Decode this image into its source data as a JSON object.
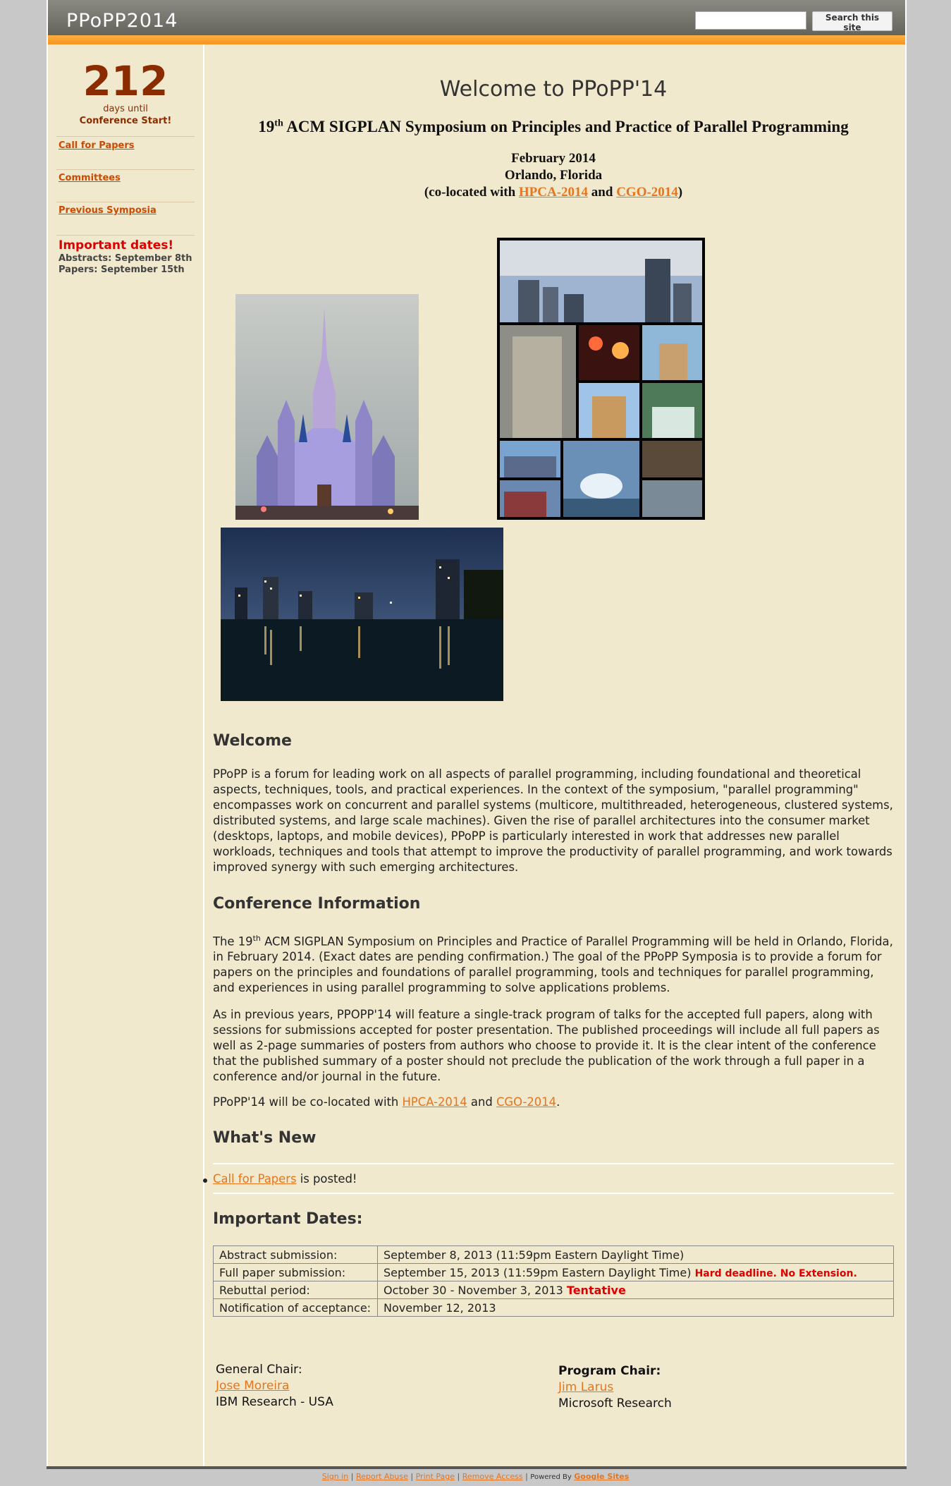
{
  "header": {
    "site_title": "PPoPP2014",
    "search_placeholder": "",
    "search_button": "Search this site"
  },
  "sidebar": {
    "countdown_number": "212",
    "countdown_line1": "days until",
    "countdown_line2": "Conference Start!",
    "links": [
      "Call for Papers",
      "Committees",
      "Previous Symposia"
    ],
    "important_title": "Important dates!",
    "important_lines": [
      "Abstracts: September 8th",
      "Papers: September 15th"
    ]
  },
  "main": {
    "welcome_title": "Welcome to PPoPP'14",
    "symposium_prefix": "19",
    "symposium_sup": "th",
    "symposium_rest": "ACM SIGPLAN Symposium on Principles and Practice of Parallel Programming",
    "date": "February 2014",
    "location": "Orlando, Florida",
    "coloc_prefix": "(co-located with",
    "coloc_link1": "HPCA-2014",
    "coloc_and": "and",
    "coloc_link2": "CGO-2014",
    "coloc_suffix": ")",
    "welcome_heading": "Welcome",
    "welcome_para": "PPoPP is a forum for leading work on all aspects of parallel programming, including foundational and theoretical aspects, techniques, tools, and practical experiences. In the context of the symposium, \"parallel programming\" encompasses work on concurrent and parallel systems (multicore, multithreaded, heterogeneous, clustered systems, distributed systems, and large scale machines). Given the rise of parallel architectures into the consumer market (desktops, laptops, and mobile devices), PPoPP is particularly interested in work that addresses new parallel workloads, techniques and tools that attempt to improve the productivity of parallel programming, and work towards improved synergy with such emerging architectures.",
    "conf_info_heading": "Conference Information",
    "conf_para1_prefix": "The 19",
    "conf_para1_sup": "th",
    "conf_para1_rest": " ACM SIGPLAN Symposium on Principles and Practice of Parallel Programming will be held in Orlando, Florida, in February 2014. (Exact dates are pending confirmation.) The goal of the PPoPP Symposia is to provide a forum for papers on the principles and foundations of parallel programming, tools and techniques for parallel programming, and experiences in using parallel programming to solve applications problems.",
    "conf_para2": "As in previous years, PPOPP'14 will feature a single-track program of talks for the accepted full papers, along with sessions for submissions accepted for poster presentation. The published proceedings will include all full papers as well as 2-page summaries of posters from authors who choose to provide it. It is the clear intent of the conference that the published summary of a poster should not preclude the publication of the work through a full paper in a conference and/or journal in the future.",
    "coloc_para_prefix": "PPoPP'14 will be co-located with ",
    "coloc_para_link1": "HPCA-2014",
    "coloc_para_and": " and ",
    "coloc_para_link2": "CGO-2014",
    "coloc_para_suffix": ".",
    "whats_new_heading": "What's New",
    "news_link": "Call for Papers",
    "news_rest": " is posted!",
    "dates_heading": "Important Dates:",
    "dates": [
      {
        "label": "Abstract submission:",
        "value": "September 8, 2013 (11:59pm Eastern Daylight Time)",
        "note": ""
      },
      {
        "label": "Full paper submission:",
        "value": "September 15, 2013 (11:59pm Eastern Daylight Time)",
        "note": "Hard deadline. No Extension."
      },
      {
        "label": "Rebuttal period:",
        "value": "October 30 - November 3, 2013",
        "note": "Tentative"
      },
      {
        "label": "Notification of acceptance:",
        "value": "November 12, 2013",
        "note": ""
      }
    ],
    "general_chair_title": "General Chair:",
    "general_chair_name": "Jose Moreira",
    "general_chair_org": "IBM Research - USA",
    "program_chair_title": "Program Chair:",
    "program_chair_name": "Jim Larus",
    "program_chair_org": "Microsoft Research"
  },
  "footer": {
    "links": [
      "Sign in",
      "Report Abuse",
      "Print Page",
      "Remove Access"
    ],
    "powered_by": "Powered By",
    "google_sites": "Google Sites",
    "separator": "|"
  }
}
